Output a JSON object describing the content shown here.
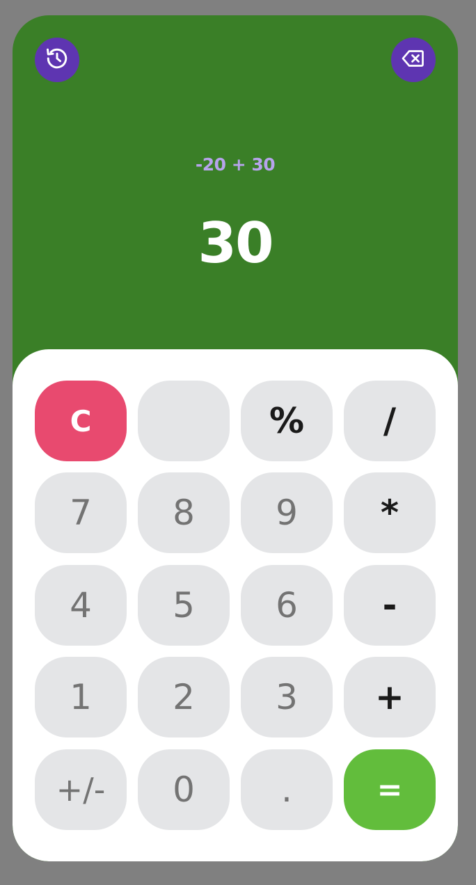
{
  "display": {
    "expression": "-20 + 30",
    "result": "30"
  },
  "icons": {
    "history": "history-icon",
    "backspace": "backspace-icon"
  },
  "colors": {
    "display_background": "#3a7f27",
    "icon_button": "#5e35b1",
    "expression_text": "#b7a4ec",
    "clear_key": "#e84a6f",
    "equals_key": "#62bd3c",
    "key_background": "#e4e5e7"
  },
  "keys": {
    "clear": "C",
    "blank": "",
    "percent": "%",
    "divide": "/",
    "seven": "7",
    "eight": "8",
    "nine": "9",
    "multiply": "*",
    "four": "4",
    "five": "5",
    "six": "6",
    "minus": "-",
    "one": "1",
    "two": "2",
    "three": "3",
    "plus": "+",
    "sign": "+/-",
    "zero": "0",
    "decimal": ".",
    "equals": "="
  }
}
